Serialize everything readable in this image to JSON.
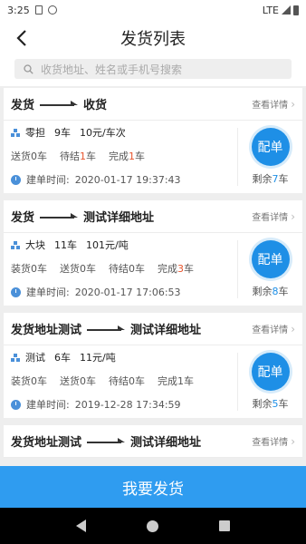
{
  "status_bar": {
    "time": "3:25",
    "network": "LTE"
  },
  "header": {
    "back_icon": "chevron-left-icon",
    "title": "发货列表"
  },
  "search": {
    "placeholder": "收货地址、姓名或手机号搜索"
  },
  "orders": [
    {
      "from": "发货",
      "to": "收货",
      "detail_label": "查看详情",
      "goods": "零担",
      "count": "9车",
      "price": "10元/车次",
      "statuses": [
        {
          "label": "送货",
          "value": "0",
          "unit": "车",
          "highlight": false
        },
        {
          "label": "待结",
          "value": "1",
          "unit": "车",
          "highlight": true
        },
        {
          "label": "完成",
          "value": "1",
          "unit": "车",
          "highlight": true
        }
      ],
      "time_label": "建单时间:",
      "time": "2020-01-17 19:37:43",
      "action": "配单",
      "remain_label": "剩余",
      "remain_value": "7",
      "remain_unit": "车"
    },
    {
      "from": "发货",
      "to": "测试详细地址",
      "detail_label": "查看详情",
      "goods": "大块",
      "count": "11车",
      "price": "101元/吨",
      "statuses": [
        {
          "label": "装货",
          "value": "0",
          "unit": "车",
          "highlight": false
        },
        {
          "label": "送货",
          "value": "0",
          "unit": "车",
          "highlight": false
        },
        {
          "label": "待结",
          "value": "0",
          "unit": "车",
          "highlight": false
        },
        {
          "label": "完成",
          "value": "3",
          "unit": "车",
          "highlight": true
        }
      ],
      "time_label": "建单时间:",
      "time": "2020-01-17 17:06:53",
      "action": "配单",
      "remain_label": "剩余",
      "remain_value": "8",
      "remain_unit": "车"
    },
    {
      "from": "发货地址测试",
      "to": "测试详细地址",
      "detail_label": "查看详情",
      "goods": "测试",
      "count": "6车",
      "price": "11元/吨",
      "statuses": [
        {
          "label": "装货",
          "value": "0",
          "unit": "车",
          "highlight": false
        },
        {
          "label": "送货",
          "value": "0",
          "unit": "车",
          "highlight": false
        },
        {
          "label": "待结",
          "value": "0",
          "unit": "车",
          "highlight": false
        },
        {
          "label": "完成",
          "value": "1",
          "unit": "车",
          "highlight": false
        }
      ],
      "time_label": "建单时间:",
      "time": "2019-12-28 17:34:59",
      "action": "配单",
      "remain_label": "剩余",
      "remain_value": "5",
      "remain_unit": "车"
    },
    {
      "from": "发货地址测试",
      "to": "测试详细地址",
      "detail_label": "查看详情"
    }
  ],
  "bottom_button": {
    "label": "我要发货"
  },
  "colors": {
    "accent": "#1e8fe6",
    "highlight": "#e8542c",
    "bottom_button": "#2f9cf0"
  }
}
